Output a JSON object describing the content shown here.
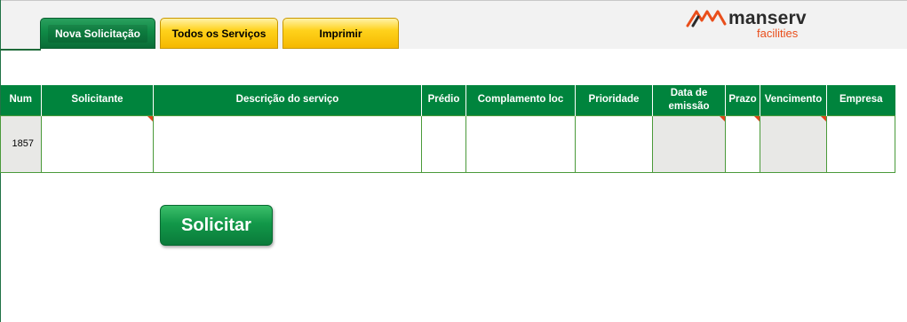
{
  "tabs": {
    "nova": "Nova Solicitação",
    "todos": "Todos os Serviços",
    "imprimir": "Imprimir"
  },
  "logo": {
    "brand": "manserv",
    "sub": "facilities"
  },
  "table": {
    "headers": [
      "Num",
      "Solicitante",
      "Descrição do serviço",
      "Prédio",
      "Complamento loc",
      "Prioridade",
      "Data de emissão",
      "Prazo",
      "Vencimento",
      "Empresa"
    ],
    "row": {
      "num": "1857",
      "solicitante": "",
      "descricao": "",
      "predio": "",
      "complemento": "",
      "prioridade": "",
      "data_emissao": "",
      "prazo": "",
      "vencimento": "",
      "empresa": ""
    }
  },
  "button": {
    "solicitar": "Solicitar"
  },
  "colors": {
    "header_green": "#00843d",
    "tab_yellow": "#ffd21c",
    "accent_orange": "#e94e1b"
  }
}
